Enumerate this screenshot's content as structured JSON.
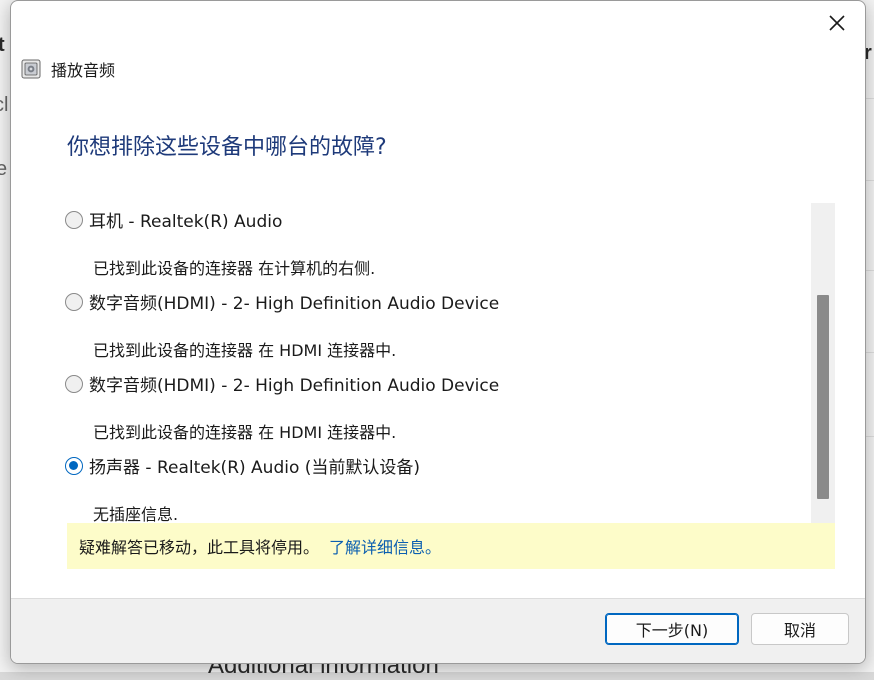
{
  "background": {
    "frag_left_1": "t",
    "frag_left_2": "cl",
    "frag_left_3": "e",
    "frag_right_1": "r",
    "frag_bottom": "Additional information"
  },
  "dialog": {
    "app_title": "播放音频",
    "question": "你想排除这些设备中哪台的故障?",
    "options": [
      {
        "label": "耳机 - Realtek(R) Audio",
        "desc": "已找到此设备的连接器 在计算机的右侧.",
        "checked": false
      },
      {
        "label": "数字音频(HDMI) - 2- High Definition Audio Device",
        "desc": "已找到此设备的连接器 在 HDMI 连接器中.",
        "checked": false
      },
      {
        "label": "数字音频(HDMI) - 2- High Definition Audio Device",
        "desc": "已找到此设备的连接器 在 HDMI 连接器中.",
        "checked": false
      },
      {
        "label": "扬声器 - Realtek(R) Audio (当前默认设备)",
        "desc": "无插座信息.",
        "checked": true
      }
    ],
    "info_text": "疑难解答已移动，此工具将停用。",
    "info_link": "了解详细信息。",
    "next_button": "下一步(N)",
    "cancel_button": "取消"
  },
  "colors": {
    "accent": "#0067c0",
    "question": "#1e3a7a",
    "info_bar": "#fdfcc9",
    "link": "#0b5fb0"
  },
  "icons": {
    "close": "close-icon",
    "app": "speaker-app-icon"
  }
}
